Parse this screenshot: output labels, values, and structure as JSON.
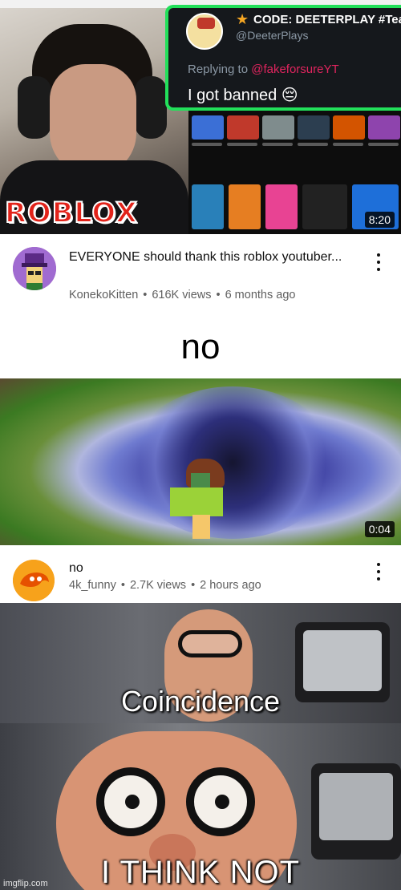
{
  "video1": {
    "thumbnail": {
      "tweet": {
        "code_line": "CODE: DEETERPLAY #Tea",
        "handle": "@DeeterPlays",
        "replying_prefix": "Replying to ",
        "replying_to": "@fakeforsureYT",
        "message": "I got banned 😔"
      },
      "logo": "ROBLOX",
      "duration": "8:20"
    },
    "title": "EVERYONE should thank this roblox youtuber...",
    "channel": "KonekoKitten",
    "views": "616K views",
    "age": "6 months ago"
  },
  "video2": {
    "thumbnail": {
      "caption": "no",
      "duration": "0:04"
    },
    "title": "no",
    "channel": "4k_funny",
    "views": "2.7K views",
    "age": "2 hours ago"
  },
  "meme": {
    "top_caption": "Coincidence",
    "bottom_caption": "I THINK NOT",
    "watermark": "imgflip.com"
  },
  "separator": "•",
  "colors": {
    "accent_green": "#22e05a",
    "roblox_red": "#e2231a",
    "text_primary": "#0f0f0f",
    "text_secondary": "#606060"
  }
}
